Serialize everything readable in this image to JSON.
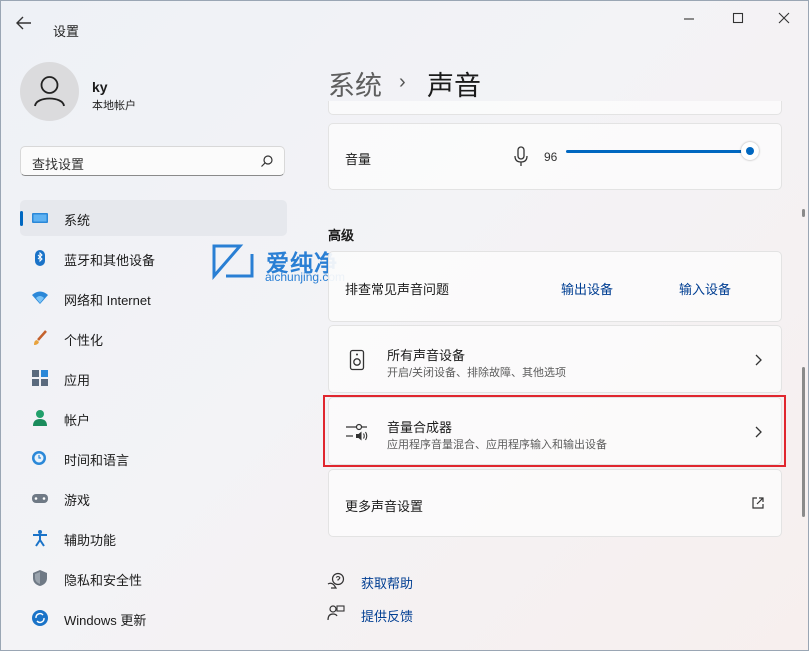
{
  "window": {
    "title": "设置"
  },
  "profile": {
    "name": "ky",
    "account_type": "本地帐户"
  },
  "search": {
    "placeholder": "查找设置"
  },
  "nav": {
    "items": [
      {
        "label": "系统",
        "icon": "system-icon"
      },
      {
        "label": "蓝牙和其他设备",
        "icon": "bluetooth-icon"
      },
      {
        "label": "网络和 Internet",
        "icon": "network-icon"
      },
      {
        "label": "个性化",
        "icon": "personalization-icon"
      },
      {
        "label": "应用",
        "icon": "apps-icon"
      },
      {
        "label": "帐户",
        "icon": "accounts-icon"
      },
      {
        "label": "时间和语言",
        "icon": "time-language-icon"
      },
      {
        "label": "游戏",
        "icon": "gaming-icon"
      },
      {
        "label": "辅助功能",
        "icon": "accessibility-icon"
      },
      {
        "label": "隐私和安全性",
        "icon": "privacy-icon"
      },
      {
        "label": "Windows 更新",
        "icon": "windows-update-icon"
      }
    ],
    "selected": "系统"
  },
  "breadcrumb": {
    "parent": "系统",
    "separator": "›",
    "current": "声音"
  },
  "volume": {
    "label": "音量",
    "value": "96",
    "level_percent": 96
  },
  "advanced": {
    "title": "高级",
    "troubleshoot": {
      "label": "排查常见声音问题",
      "output_link": "输出设备",
      "input_link": "输入设备"
    },
    "all_devices": {
      "title": "所有声音设备",
      "subtitle": "开启/关闭设备、排除故障、其他选项"
    },
    "mixer": {
      "title": "音量合成器",
      "subtitle": "应用程序音量混合、应用程序输入和输出设备"
    },
    "more": {
      "label": "更多声音设置"
    }
  },
  "help": {
    "get_help": "获取帮助",
    "feedback": "提供反馈"
  },
  "watermark": {
    "text": "爱纯净",
    "sub": "aichunjing.com"
  },
  "colors": {
    "accent": "#0067c0",
    "highlight_border": "#e0262e"
  }
}
